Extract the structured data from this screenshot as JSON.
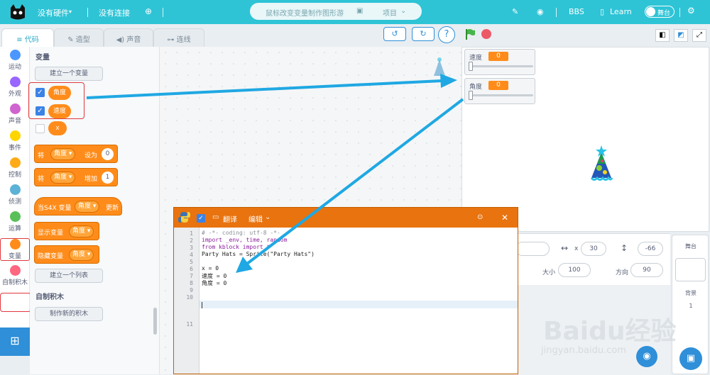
{
  "colors": {
    "topbar": "#2ec4d6",
    "variable_orange": "#ff8c1a",
    "python_title": "#e8730f",
    "highlight_red": "#e0383e",
    "arrow_blue": "#1fa8e3",
    "accent_blue": "#2f8fd8"
  },
  "topbar": {
    "hardware": "没有硬件",
    "connection": "没有连接",
    "project_title": "鼠标改变变量制作图形游",
    "project_menu": "项目",
    "bbs": "BBS",
    "learn": "Learn",
    "stage_toggle": "舞台"
  },
  "tabs": {
    "code": "代码",
    "costume": "造型",
    "sound": "声音",
    "wiring": "连线"
  },
  "categories": [
    {
      "label": "运动",
      "color": "#4c97ff"
    },
    {
      "label": "外观",
      "color": "#9966ff"
    },
    {
      "label": "声音",
      "color": "#cf63cf"
    },
    {
      "label": "事件",
      "color": "#ffd500"
    },
    {
      "label": "控制",
      "color": "#ffab19"
    },
    {
      "label": "侦测",
      "color": "#5cb1d6"
    },
    {
      "label": "运算",
      "color": "#59c059"
    },
    {
      "label": "变量",
      "color": "#ff8c1a"
    },
    {
      "label": "自制积木",
      "color": "#ff6680"
    }
  ],
  "palette": {
    "section_variables": "变量",
    "make_variable": "建立一个变量",
    "variables": [
      {
        "name": "角度",
        "checked": true
      },
      {
        "name": "速度",
        "checked": true
      },
      {
        "name": "x",
        "checked": false
      }
    ],
    "set_block": {
      "w1": "将",
      "var": "角度",
      "w2": "设为",
      "value": "0"
    },
    "change_block": {
      "w1": "将",
      "var": "角度",
      "w2": "增加",
      "value": "1"
    },
    "hat_block": {
      "w1": "当S4X 变量",
      "var": "角度",
      "w2": "更新"
    },
    "show_block": {
      "w1": "显示变量",
      "var": "角度"
    },
    "hide_block": {
      "w1": "隐藏变量",
      "var": "角度"
    },
    "make_list": "建立一个列表",
    "section_my_blocks": "自制积木",
    "make_block": "制作新的积木"
  },
  "code_toolbar": {
    "help": "?"
  },
  "stage": {
    "monitors": [
      {
        "name": "速度",
        "value": "0"
      },
      {
        "name": "角度",
        "value": "0"
      }
    ]
  },
  "sprite_info": {
    "x_label": "x",
    "x_value": "30",
    "y_value": "-66",
    "size_label": "大小",
    "size_value": "100",
    "direction_label": "方向",
    "direction_value": "90"
  },
  "stage_column": {
    "title": "舞台",
    "backdrop_label": "背景",
    "backdrop_count": "1"
  },
  "python_window": {
    "translate": "翻译",
    "edit": "编辑",
    "line_numbers": [
      "1",
      "2",
      "3",
      "4",
      "5",
      "6",
      "7",
      "8",
      "9",
      "10",
      "11"
    ],
    "lines": [
      "# -*- coding: utf-8 -*-",
      "import _env, time, random",
      "from kblock import *",
      "Party Hats = Sprite(\"Party Hats\")",
      "",
      "x = 0",
      "速度 = 0",
      "角度 = 0",
      "",
      "",
      ""
    ]
  },
  "watermark": {
    "text": "Baidu经验",
    "url": "jingyan.baidu.com"
  }
}
